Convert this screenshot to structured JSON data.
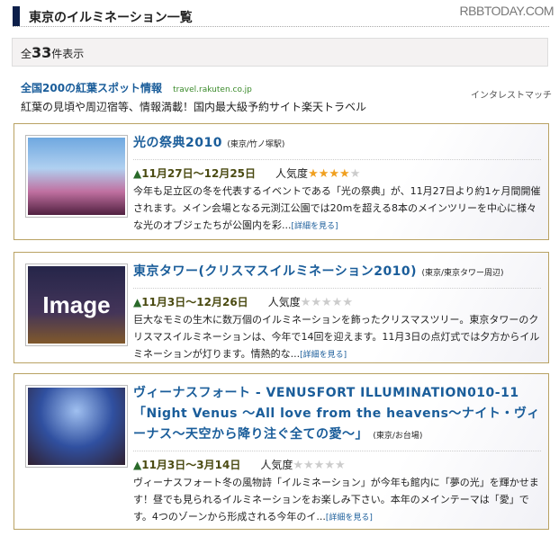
{
  "header": {
    "title": "東京のイルミネーション一覧",
    "brand": "RBBTODAY.COM"
  },
  "count": {
    "prefix": "全",
    "number": "33",
    "suffix": "件表示"
  },
  "ad": {
    "headline": "全国200の紅葉スポット情報",
    "url": "travel.rakuten.co.jp",
    "description": "紅葉の見頃や周辺宿等、情報満載！国内最大級予約サイト楽天トラベル",
    "label": "インタレストマッチ"
  },
  "popularity_label": "人気度",
  "more_label": "[詳細を見る]",
  "items": [
    {
      "title": "光の祭典2010",
      "location": "(東京/竹ノ塚駅)",
      "date": "11月27日～12月25日",
      "rating": 4,
      "description": "今年も足立区の冬を代表するイベントである「光の祭典」が、11月27日より約1ヶ月間開催されます。メイン会場となる元渕江公園では20mを超える8本のメインツリーを中心に様々な光のオブジェたちが公園内を彩..."
    },
    {
      "title": "東京タワー(クリスマスイルミネーション2010)",
      "location": "(東京/東京タワー周辺)",
      "date": "11月3日～12月26日",
      "rating": 0,
      "thumb_text": "Image",
      "description": "巨大なモミの生木に数万個のイルミネーションを飾ったクリスマスツリー。東京タワーのクリスマスイルミネーションは、今年で14回を迎えます。11月3日の点灯式では夕方からイルミネーションが灯ります。情熱的な..."
    },
    {
      "title": "ヴィーナスフォート - VENUSFORT ILLUMINATION010-11 「Night Venus ～All love from the heavens～ナイト・ヴィーナス～天空から降り注ぐ全ての愛～」",
      "location": "(東京/お台場)",
      "date": "11月3日～3月14日",
      "rating": 0,
      "description": "ヴィーナスフォート冬の風物詩「イルミネーション」が今年も館内に「夢の光」を輝かせます！昼でも見られるイルミネーションをお楽しみ下さい。本年のメインテーマは「愛」です。4つのゾーンから形成される今年のイ..."
    }
  ]
}
